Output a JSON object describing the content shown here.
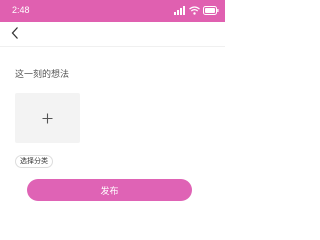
{
  "status_bar": {
    "time": "2:48",
    "icons": [
      "signal-icon",
      "wifi-icon",
      "battery-icon"
    ],
    "background": "#e060b0"
  },
  "nav": {
    "back_icon": "chevron-left-icon"
  },
  "form": {
    "thought_placeholder": "这一刻的想法",
    "thought_value": "",
    "add_photo_icon": "plus-icon",
    "category_label": "选择分类",
    "publish_label": "发布"
  },
  "colors": {
    "accent": "#df63b5",
    "photo_tile": "#f3f3f3"
  }
}
